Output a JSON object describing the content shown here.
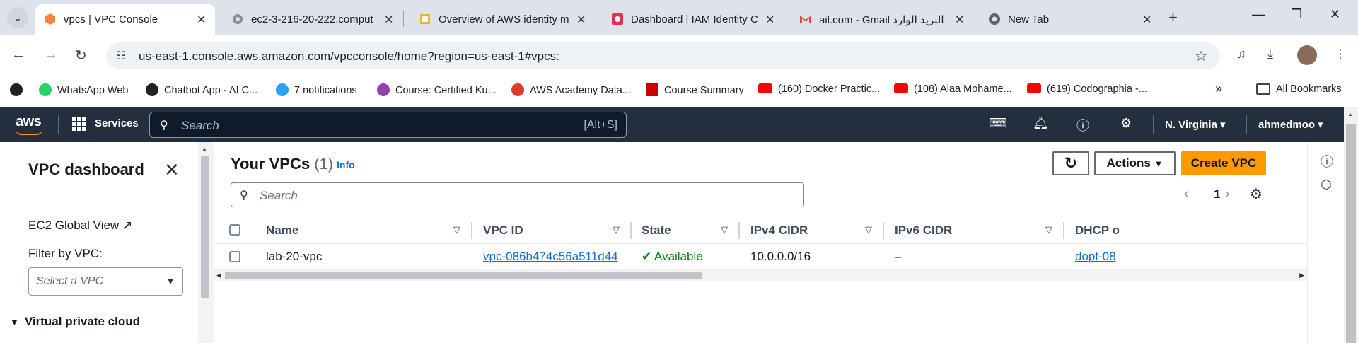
{
  "browser": {
    "tabs": [
      {
        "title": "vpcs | VPC Console",
        "active": true
      },
      {
        "title": "ec2-3-216-20-222.comput",
        "active": false
      },
      {
        "title": "Overview of AWS identity m",
        "active": false
      },
      {
        "title": "Dashboard | IAM Identity C",
        "active": false
      },
      {
        "title": "ail.com - Gmail البريد الوارد",
        "active": false
      },
      {
        "title": "New Tab",
        "active": false
      }
    ],
    "url": "us-east-1.console.aws.amazon.com/vpcconsole/home?region=us-east-1#vpcs:",
    "bookmarks": [
      {
        "label": "WhatsApp Web",
        "color": "#25d366"
      },
      {
        "label": "Chatbot App - AI C...",
        "color": "#222222"
      },
      {
        "label": "7 notifications",
        "color": "#2aa1f2"
      },
      {
        "label": "Course: Certified Ku...",
        "color": "#8e44ad"
      },
      {
        "label": "AWS Academy Data...",
        "color": "#e23b2e"
      },
      {
        "label": "Course Summary",
        "color": "#cc0000"
      },
      {
        "label": "(160) Docker Practic...",
        "color": "#ff0000"
      },
      {
        "label": "(108) Alaa Mohame...",
        "color": "#ff0000"
      },
      {
        "label": "(619) Codographia -...",
        "color": "#ff0000"
      }
    ],
    "all_bookmarks": "All Bookmarks"
  },
  "aws_header": {
    "logo": "aws",
    "services": "Services",
    "search_placeholder": "Search",
    "search_shortcut": "[Alt+S]",
    "region": "N. Virginia",
    "user": "ahmedmoo"
  },
  "sidebar": {
    "title": "VPC dashboard",
    "ec2_global_view": "EC2 Global View",
    "filter_label": "Filter by VPC:",
    "filter_placeholder": "Select a VPC",
    "section": "Virtual private cloud"
  },
  "main": {
    "title": "Your VPCs",
    "count": "(1)",
    "info": "Info",
    "actions": "Actions",
    "create": "Create VPC",
    "search_placeholder": "Search",
    "page": "1",
    "columns": [
      "Name",
      "VPC ID",
      "State",
      "IPv4 CIDR",
      "IPv6 CIDR",
      "DHCP o"
    ],
    "rows": [
      {
        "name": "lab-20-vpc",
        "vpc_id": "vpc-086b474c56a511d44",
        "state": "Available",
        "ipv4": "10.0.0.0/16",
        "ipv6": "–",
        "dhcp": "dopt-08"
      }
    ]
  },
  "colors": {
    "aws_header": "#232f3e",
    "primary_button": "#ff9900",
    "link": "#0972d3",
    "success": "#037f0c"
  }
}
